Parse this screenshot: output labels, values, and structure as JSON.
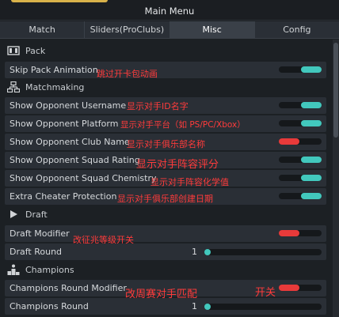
{
  "header": {
    "title": "Main Menu"
  },
  "tabs": [
    {
      "label": "Match"
    },
    {
      "label": "Sliders(ProClubs)"
    },
    {
      "label": "Misc"
    },
    {
      "label": "Config"
    }
  ],
  "sections": {
    "pack": {
      "label": "Pack",
      "icon": "pack-icon"
    },
    "matchmaking": {
      "label": "Matchmaking",
      "icon": "network-icon"
    },
    "draft": {
      "label": "Draft",
      "icon": "play-icon"
    },
    "champions": {
      "label": "Champions",
      "icon": "podium-icon"
    }
  },
  "rows": {
    "skip_pack": {
      "label": "Skip Pack Animation",
      "note": "跳过开卡包动画",
      "state": "on"
    },
    "show_username": {
      "label": "Show Opponent Username",
      "note": "显示对手ID名字",
      "state": "on"
    },
    "show_platform": {
      "label": "Show Opponent Platform",
      "note": "显示对手平台（如 PS/PC/Xbox）",
      "state": "on"
    },
    "show_club": {
      "label": "Show Opponent Club Name",
      "note": "显示对手俱乐部名称",
      "state": "off"
    },
    "show_rating": {
      "label": "Show Opponent Squad Rating",
      "note": "显示对手阵容评分",
      "state": "on"
    },
    "show_chemistry": {
      "label": "Show Opponent Squad Chemistry",
      "note": "显示对手阵容化学值",
      "state": "on"
    },
    "extra_cheater": {
      "label": "Extra Cheater Protection",
      "note": "显示对手俱乐部创建日期",
      "state": "on"
    },
    "draft_modifier": {
      "label": "Draft Modifier",
      "note": "改征兆等级开关",
      "state": "off"
    },
    "draft_round": {
      "label": "Draft Round",
      "value": "1"
    },
    "champions_modifier": {
      "label": "Champions Round Modifier",
      "note": "改周赛对手匹配",
      "note2": "开关",
      "state": "off"
    },
    "champions_round": {
      "label": "Champions Round",
      "value": "1"
    }
  },
  "colors": {
    "toggle_on": "#42c8bd",
    "toggle_off": "#e83a3a",
    "note": "#ff3b3b"
  }
}
